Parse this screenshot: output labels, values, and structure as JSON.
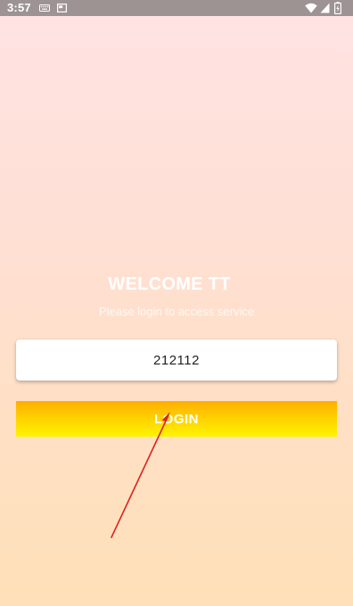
{
  "status_bar": {
    "time": "3:57",
    "icons": [
      "keyboard-icon",
      "screen-icon",
      "wifi-icon",
      "signal-icon",
      "battery-icon"
    ]
  },
  "login": {
    "title": "WELCOME TT",
    "subtitle": "Please login to access service",
    "code_value": "212112",
    "button_label": "LOGIN"
  },
  "colors": {
    "background_top": "#FFE3E4",
    "background_bottom": "#FFE0B8",
    "status_bar": "#9E9393",
    "button_top": "#FFAE00",
    "button_bottom": "#FFF300",
    "annotation_arrow": "#E02020"
  }
}
